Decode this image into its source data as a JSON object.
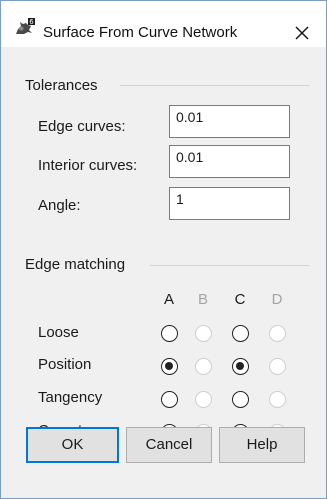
{
  "window": {
    "title": "Surface From Curve Network",
    "icon": "rhino-app-icon",
    "close_icon": "close-icon"
  },
  "tolerances": {
    "group_title": "Tolerances",
    "fields": [
      {
        "label": "Edge curves:",
        "value": "0.01"
      },
      {
        "label": "Interior curves:",
        "value": "0.01"
      },
      {
        "label": "Angle:",
        "value": "1"
      }
    ]
  },
  "edge_matching": {
    "group_title": "Edge matching",
    "columns": [
      {
        "label": "A",
        "enabled": true
      },
      {
        "label": "B",
        "enabled": false
      },
      {
        "label": "C",
        "enabled": true
      },
      {
        "label": "D",
        "enabled": false
      }
    ],
    "rows": [
      {
        "label": "Loose",
        "selected": [
          false,
          false,
          false,
          false
        ]
      },
      {
        "label": "Position",
        "selected": [
          true,
          false,
          true,
          false
        ]
      },
      {
        "label": "Tangency",
        "selected": [
          false,
          false,
          false,
          false
        ]
      },
      {
        "label": "Curvature",
        "selected": [
          false,
          false,
          false,
          false
        ]
      }
    ]
  },
  "buttons": {
    "ok": "OK",
    "cancel": "Cancel",
    "help": "Help"
  },
  "colors": {
    "accent": "#0078d7",
    "border": "#7a9fc4",
    "client_background": "#f0f0f0",
    "disabled_text": "#a5a5a5"
  }
}
